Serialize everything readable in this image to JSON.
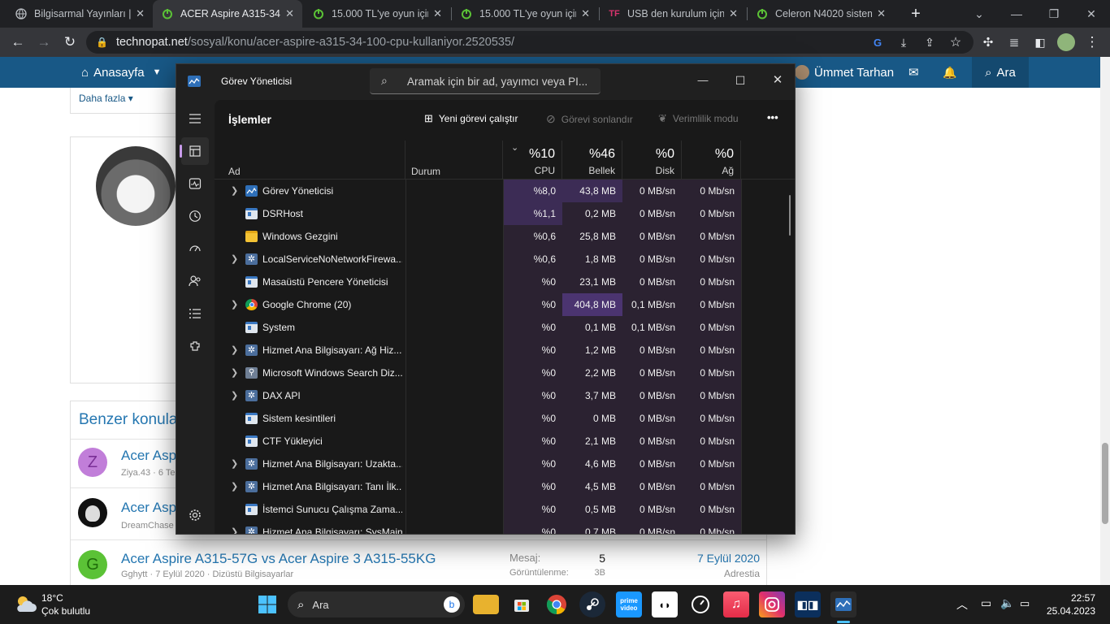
{
  "browser": {
    "tabs": [
      {
        "title": "Bilgisarmal Yayınları | \\",
        "favicon": "globe-icon",
        "active": false
      },
      {
        "title": "ACER Aspire A315-34",
        "favicon": "power-icon",
        "active": true
      },
      {
        "title": "15.000 TL'ye oyun için",
        "favicon": "power-icon",
        "active": false
      },
      {
        "title": "15.000 TL'ye oyun için",
        "favicon": "power-icon",
        "active": false
      },
      {
        "title": "USB den kurulum için",
        "favicon": "tf-icon",
        "active": false
      },
      {
        "title": "Celeron N4020 sistem",
        "favicon": "power-icon",
        "active": false
      }
    ],
    "new_tab": "+",
    "url_host": "technopat.net",
    "url_path": "/sosyal/konu/acer-aspire-a315-34-100-cpu-kullaniyor.2520535/"
  },
  "site": {
    "nav_home": "Anasayfa",
    "nav_more": "Daha fazla",
    "user_name": "Ümmet Tarhan",
    "search_label": "Ara",
    "similar_title": "Benzer konula",
    "threads": [
      {
        "title": "Acer Aspi",
        "meta": "Ziya.43 · 6 Te",
        "avatar_letter": "Z",
        "avatar_color": "#c17ed9"
      },
      {
        "title": "Acer Aspi",
        "meta": "DreamChase",
        "avatar_letter": "",
        "avatar_color": "#111111"
      },
      {
        "title": "Acer Aspire A315-57G vs Acer Aspire 3 A315-55KG",
        "meta_author": "Gghytt",
        "meta_date": "7 Eylül 2020",
        "meta_forum": "Dizüstü Bilgisayarlar",
        "avatar_letter": "G",
        "avatar_color": "#5bc236",
        "messages_label": "Mesaj:",
        "messages_value": "5",
        "views_label": "Görüntülenme:",
        "views_value": "3B",
        "last_date": "7 Eylül 2020",
        "last_user": "Adrestia"
      }
    ]
  },
  "task_manager": {
    "title": "Görev Yöneticisi",
    "search_placeholder": "Aramak için bir ad, yayımcı veya PI...",
    "section_title": "İşlemler",
    "run_new_task": "Yeni görevi çalıştır",
    "end_task": "Görevi sonlandır",
    "efficiency_mode": "Verimlilik modu",
    "more": "•••",
    "columns": {
      "name": "Ad",
      "status": "Durum",
      "cpu_pct": "%10",
      "cpu_label": "CPU",
      "mem_pct": "%46",
      "mem_label": "Bellek",
      "disk_pct": "%0",
      "disk_label": "Disk",
      "net_pct": "%0",
      "net_label": "Ağ"
    },
    "processes": [
      {
        "name": "Görev Yöneticisi",
        "expand": true,
        "icon": "taskmgr-icon",
        "cpu": "%8,0",
        "mem": "43,8 MB",
        "disk": "0 MB/sn",
        "net": "0 Mb/sn",
        "cpu_hi": 2,
        "mem_hi": 2
      },
      {
        "name": "DSRHost",
        "expand": false,
        "icon": "window-app-icon",
        "cpu": "%1,1",
        "mem": "0,2 MB",
        "disk": "0 MB/sn",
        "net": "0 Mb/sn",
        "cpu_hi": 2,
        "mem_hi": 1
      },
      {
        "name": "Windows Gezgini",
        "expand": false,
        "icon": "folder-icon",
        "cpu": "%0,6",
        "mem": "25,8 MB",
        "disk": "0 MB/sn",
        "net": "0 Mb/sn",
        "cpu_hi": 1,
        "mem_hi": 1
      },
      {
        "name": "LocalServiceNoNetworkFirewa...",
        "expand": true,
        "icon": "gear-icon",
        "cpu": "%0,6",
        "mem": "1,8 MB",
        "disk": "0 MB/sn",
        "net": "0 Mb/sn",
        "cpu_hi": 1,
        "mem_hi": 1
      },
      {
        "name": "Masaüstü Pencere Yöneticisi",
        "expand": false,
        "icon": "window-app-icon",
        "cpu": "%0",
        "mem": "23,1 MB",
        "disk": "0 MB/sn",
        "net": "0 Mb/sn",
        "cpu_hi": 1,
        "mem_hi": 1
      },
      {
        "name": "Google Chrome (20)",
        "expand": true,
        "icon": "chrome-icon",
        "cpu": "%0",
        "mem": "404,8 MB",
        "disk": "0,1 MB/sn",
        "net": "0 Mb/sn",
        "cpu_hi": 1,
        "mem_hi": 3
      },
      {
        "name": "System",
        "expand": false,
        "icon": "window-app-icon",
        "cpu": "%0",
        "mem": "0,1 MB",
        "disk": "0,1 MB/sn",
        "net": "0 Mb/sn",
        "cpu_hi": 1,
        "mem_hi": 1
      },
      {
        "name": "Hizmet Ana Bilgisayarı: Ağ Hiz...",
        "expand": true,
        "icon": "gear-icon",
        "cpu": "%0",
        "mem": "1,2 MB",
        "disk": "0 MB/sn",
        "net": "0 Mb/sn",
        "cpu_hi": 1,
        "mem_hi": 1
      },
      {
        "name": "Microsoft Windows Search Diz...",
        "expand": true,
        "icon": "search-person-icon",
        "cpu": "%0",
        "mem": "2,2 MB",
        "disk": "0 MB/sn",
        "net": "0 Mb/sn",
        "cpu_hi": 1,
        "mem_hi": 1
      },
      {
        "name": "DAX API",
        "expand": true,
        "icon": "gear-icon",
        "cpu": "%0",
        "mem": "3,7 MB",
        "disk": "0 MB/sn",
        "net": "0 Mb/sn",
        "cpu_hi": 1,
        "mem_hi": 1
      },
      {
        "name": "Sistem kesintileri",
        "expand": false,
        "icon": "window-app-icon",
        "cpu": "%0",
        "mem": "0 MB",
        "disk": "0 MB/sn",
        "net": "0 Mb/sn",
        "cpu_hi": 1,
        "mem_hi": 1
      },
      {
        "name": "CTF Yükleyici",
        "expand": false,
        "icon": "window-app-icon",
        "cpu": "%0",
        "mem": "2,1 MB",
        "disk": "0 MB/sn",
        "net": "0 Mb/sn",
        "cpu_hi": 1,
        "mem_hi": 1
      },
      {
        "name": "Hizmet Ana Bilgisayarı: Uzakta...",
        "expand": true,
        "icon": "gear-icon",
        "cpu": "%0",
        "mem": "4,6 MB",
        "disk": "0 MB/sn",
        "net": "0 Mb/sn",
        "cpu_hi": 1,
        "mem_hi": 1
      },
      {
        "name": "Hizmet Ana Bilgisayarı: Tanı İlk...",
        "expand": true,
        "icon": "gear-icon",
        "cpu": "%0",
        "mem": "4,5 MB",
        "disk": "0 MB/sn",
        "net": "0 Mb/sn",
        "cpu_hi": 1,
        "mem_hi": 1
      },
      {
        "name": "İstemci Sunucu Çalışma Zama...",
        "expand": false,
        "icon": "window-app-icon",
        "cpu": "%0",
        "mem": "0,5 MB",
        "disk": "0 MB/sn",
        "net": "0 Mb/sn",
        "cpu_hi": 1,
        "mem_hi": 1
      },
      {
        "name": "Hizmet Ana Bilgisayarı: SysMain",
        "expand": true,
        "icon": "gear-icon",
        "cpu": "%0",
        "mem": "0,7 MB",
        "disk": "0 MB/sn",
        "net": "0 Mb/sn",
        "cpu_hi": 1,
        "mem_hi": 1
      }
    ],
    "heat_colors": {
      "1": "#2b2231",
      "2": "#3c2c55",
      "3": "#4b3470"
    }
  },
  "taskbar": {
    "weather_temp": "18°C",
    "weather_desc": "Çok bulutlu",
    "search_label": "Ara",
    "time": "22:57",
    "date": "25.04.2023"
  }
}
